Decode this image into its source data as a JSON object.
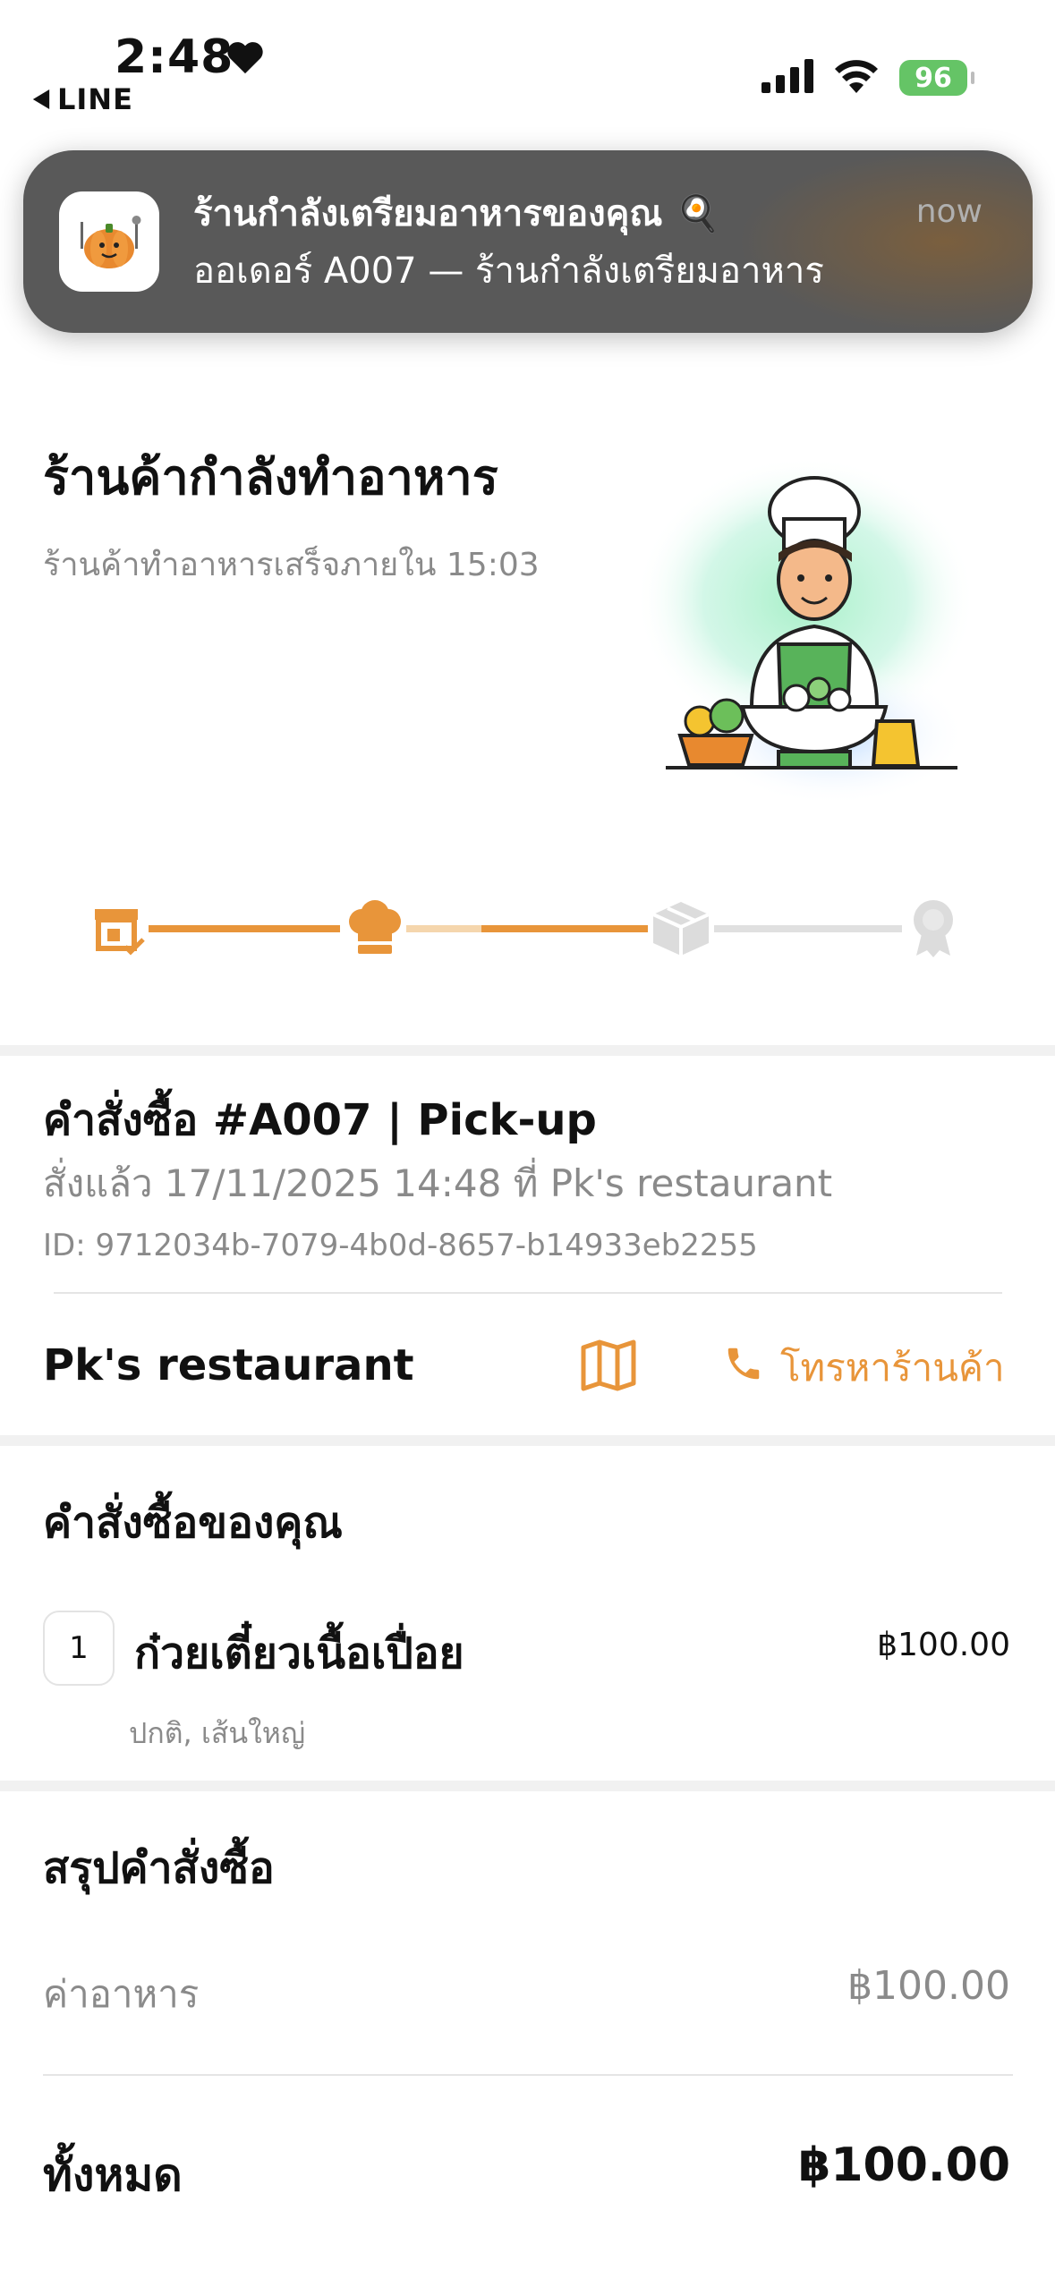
{
  "status_bar": {
    "time": "2:48",
    "back_app": "LINE",
    "battery": "96"
  },
  "notification": {
    "title": "ร้านกำลังเตรียมอาหารของคุณ 🍳",
    "body": "ออเดอร์ A007 — ร้านกำลังเตรียมอาหาร",
    "time": "now"
  },
  "header": {
    "title": "ร้านค้ากำลังทำอาหาร",
    "subtitle": "ร้านค้าทำอาหารเสร็จภายใน 15:03"
  },
  "progress": {
    "steps": [
      "store-check-icon",
      "chef-hat-icon",
      "package-icon",
      "award-icon"
    ],
    "active_color": "#e8953a",
    "inactive_color": "#e0e0e0",
    "current_step": 2,
    "total_steps": 4
  },
  "order": {
    "title": "คำสั่งซื้อ #A007 | Pick-up",
    "meta": "สั่งแล้ว  17/11/2025 14:48  ที่ Pk's restaurant",
    "id_text": "ID: 9712034b-7079-4b0d-8657-b14933eb2255",
    "restaurant": "Pk's restaurant",
    "call_label": "โทรหาร้านค้า"
  },
  "items_section": {
    "title": "คำสั่งซื้อของคุณ",
    "items": [
      {
        "qty": "1",
        "name": "ก๋วยเตี๋ยวเนื้อเปื่อย",
        "price": "฿100.00",
        "options": "ปกติ, เส้นใหญ่"
      }
    ]
  },
  "summary": {
    "title": "สรุปคำสั่งซื้อ",
    "food_label": "ค่าอาหาร",
    "food_value": "฿100.00",
    "total_label": "ทั้งหมด",
    "total_value": "฿100.00"
  },
  "colors": {
    "accent": "#e8953a",
    "notification_bg": "#595959",
    "battery": "#65c466"
  }
}
